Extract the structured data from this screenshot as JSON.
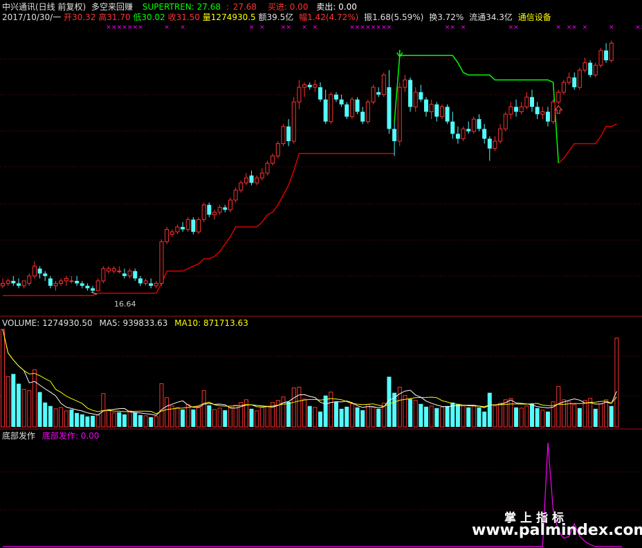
{
  "header": {
    "line1": {
      "stock": "中兴通讯(日线 前复权)",
      "indicator": "多空来回赚",
      "st_label": "SUPERTREN: 27.68",
      "st_value2": "27.68",
      "buy": "买进: 0.00",
      "sell": "卖出: 0.00"
    },
    "line2": {
      "date": "2017/10/30/一",
      "open": "开30.32",
      "high": "高31.70",
      "low": "低30.02",
      "close": "收31.50",
      "vol": "量1274930.5",
      "amount": "额39.5亿",
      "change": "幅1.42(4.72%)",
      "amplitude": "振1.68(5.59%)",
      "turnover": "换3.72%",
      "float": "流通34.3亿",
      "sector": "通信设备"
    }
  },
  "panels": {
    "volume_title": "VOLUME: 1274930.50",
    "ma5_label": "MA5: 939833.63",
    "ma10_label": "MA10: 871713.63",
    "bottom_title": "底部发作",
    "bottom_value": "底部发作: 0.00"
  },
  "annotations": {
    "low_label": "16.64"
  },
  "watermark": {
    "cn": "掌上指标",
    "url": "www.palmindex.com"
  },
  "colors": {
    "up": "#ff3232",
    "down": "#54fcfc",
    "supertrend_down": "#00ff00",
    "supertrend_up": "#dd0000",
    "marker": "#ff00ff",
    "ma5": "#ffffff",
    "ma10": "#ffff00",
    "bottom_signal": "#ff00ff"
  },
  "chart_data": [
    {
      "type": "candlestick",
      "series_name": "中兴通讯",
      "candles": [
        [
          16.9,
          17.2,
          16.8,
          17.0
        ],
        [
          17.0,
          17.2,
          16.9,
          17.1
        ],
        [
          17.1,
          17.3,
          16.9,
          17.0
        ],
        [
          17.0,
          17.2,
          16.8,
          16.9
        ],
        [
          16.9,
          17.1,
          16.8,
          17.1
        ],
        [
          17.0,
          17.4,
          16.9,
          17.3
        ],
        [
          17.3,
          17.9,
          17.2,
          17.7
        ],
        [
          17.6,
          17.7,
          17.2,
          17.4
        ],
        [
          17.4,
          17.5,
          17.1,
          17.3
        ],
        [
          17.2,
          17.3,
          16.8,
          16.9
        ],
        [
          16.9,
          17.1,
          16.7,
          17.0
        ],
        [
          17.0,
          17.2,
          16.9,
          17.1
        ],
        [
          17.1,
          17.3,
          16.9,
          17.2
        ],
        [
          17.1,
          17.3,
          17.0,
          17.1
        ],
        [
          17.1,
          17.3,
          16.9,
          17.0
        ],
        [
          17.0,
          17.1,
          16.8,
          16.9
        ],
        [
          16.9,
          17.0,
          16.7,
          16.8
        ],
        [
          16.8,
          16.9,
          16.64,
          16.7
        ],
        [
          16.7,
          17.2,
          16.7,
          17.1
        ],
        [
          17.1,
          17.7,
          17.0,
          17.6
        ],
        [
          17.5,
          17.7,
          17.4,
          17.6
        ],
        [
          17.5,
          17.7,
          17.4,
          17.6
        ],
        [
          17.5,
          17.7,
          17.4,
          17.5
        ],
        [
          17.4,
          17.6,
          17.2,
          17.3
        ],
        [
          17.3,
          17.6,
          17.2,
          17.5
        ],
        [
          17.5,
          17.6,
          17.1,
          17.2
        ],
        [
          17.2,
          17.3,
          16.9,
          17.0
        ],
        [
          17.0,
          17.2,
          16.9,
          17.1
        ],
        [
          17.0,
          17.2,
          16.8,
          16.9
        ],
        [
          16.9,
          17.1,
          16.8,
          17.0
        ],
        [
          17.0,
          18.8,
          16.9,
          18.7
        ],
        [
          18.7,
          19.3,
          18.6,
          19.2
        ],
        [
          19.0,
          19.2,
          18.9,
          19.1
        ],
        [
          19.1,
          19.4,
          19.0,
          19.3
        ],
        [
          19.3,
          19.5,
          19.1,
          19.2
        ],
        [
          19.2,
          19.7,
          19.1,
          19.6
        ],
        [
          19.6,
          19.7,
          19.0,
          19.1
        ],
        [
          19.1,
          19.7,
          19.0,
          19.6
        ],
        [
          19.6,
          20.3,
          19.5,
          20.2
        ],
        [
          20.2,
          20.3,
          19.7,
          19.8
        ],
        [
          19.8,
          20.0,
          19.6,
          19.9
        ],
        [
          19.9,
          20.2,
          19.8,
          20.1
        ],
        [
          20.1,
          20.2,
          19.9,
          20.0
        ],
        [
          20.0,
          20.5,
          19.9,
          20.4
        ],
        [
          20.4,
          20.9,
          20.3,
          20.8
        ],
        [
          20.8,
          21.2,
          20.7,
          21.1
        ],
        [
          21.1,
          21.5,
          21.0,
          21.3
        ],
        [
          21.4,
          21.6,
          21.0,
          21.1
        ],
        [
          21.1,
          21.4,
          21.0,
          21.3
        ],
        [
          21.3,
          21.7,
          21.2,
          21.5
        ],
        [
          21.5,
          22.0,
          21.4,
          21.9
        ],
        [
          21.9,
          22.3,
          21.8,
          22.2
        ],
        [
          22.2,
          22.8,
          22.1,
          22.7
        ],
        [
          22.7,
          23.5,
          22.6,
          23.4
        ],
        [
          23.4,
          23.7,
          22.6,
          22.8
        ],
        [
          22.8,
          24.6,
          22.7,
          24.4
        ],
        [
          24.4,
          25.3,
          24.1,
          25.0
        ],
        [
          25.0,
          25.2,
          24.6,
          25.1
        ],
        [
          25.1,
          25.2,
          24.9,
          25.0
        ],
        [
          25.0,
          25.3,
          24.8,
          25.1
        ],
        [
          25.0,
          25.2,
          24.4,
          24.5
        ],
        [
          24.5,
          24.9,
          23.5,
          23.6
        ],
        [
          23.6,
          24.8,
          23.5,
          24.7
        ],
        [
          24.7,
          24.8,
          24.4,
          24.5
        ],
        [
          24.5,
          24.7,
          24.2,
          24.3
        ],
        [
          24.3,
          24.4,
          23.7,
          23.8
        ],
        [
          23.8,
          24.6,
          23.7,
          24.5
        ],
        [
          24.5,
          24.6,
          23.9,
          24.0
        ],
        [
          24.0,
          24.2,
          23.5,
          23.6
        ],
        [
          23.6,
          24.5,
          23.5,
          24.4
        ],
        [
          24.4,
          25.1,
          24.3,
          25.0
        ],
        [
          24.8,
          25.0,
          24.6,
          24.7
        ],
        [
          24.7,
          25.6,
          24.6,
          25.5
        ],
        [
          25.0,
          25.7,
          23.1,
          23.3
        ],
        [
          23.3,
          23.6,
          22.2,
          22.8
        ],
        [
          22.8,
          25.2,
          22.6,
          25.0
        ],
        [
          25.0,
          25.5,
          24.8,
          25.3
        ],
        [
          25.3,
          25.4,
          24.0,
          24.2
        ],
        [
          24.2,
          25.0,
          24.0,
          24.8
        ],
        [
          24.8,
          25.1,
          24.4,
          24.5
        ],
        [
          24.5,
          24.6,
          23.8,
          24.0
        ],
        [
          24.0,
          24.5,
          23.7,
          24.3
        ],
        [
          24.3,
          24.4,
          23.6,
          23.8
        ],
        [
          23.8,
          24.3,
          23.7,
          24.2
        ],
        [
          24.2,
          24.3,
          23.5,
          23.6
        ],
        [
          23.6,
          24.0,
          22.9,
          23.1
        ],
        [
          23.1,
          23.4,
          22.7,
          22.9
        ],
        [
          22.9,
          23.4,
          22.8,
          23.3
        ],
        [
          23.3,
          23.6,
          23.1,
          23.2
        ],
        [
          23.2,
          23.8,
          23.1,
          23.7
        ],
        [
          23.7,
          23.9,
          23.2,
          23.3
        ],
        [
          23.3,
          23.5,
          22.7,
          22.9
        ],
        [
          22.9,
          23.0,
          22.0,
          22.5
        ],
        [
          22.5,
          23.0,
          22.4,
          22.8
        ],
        [
          22.8,
          23.5,
          22.7,
          23.3
        ],
        [
          23.3,
          24.0,
          23.2,
          23.9
        ],
        [
          23.9,
          24.4,
          23.7,
          24.2
        ],
        [
          24.2,
          24.5,
          23.8,
          24.0
        ],
        [
          24.0,
          24.4,
          23.9,
          24.2
        ],
        [
          24.2,
          24.8,
          24.1,
          24.6
        ],
        [
          24.6,
          24.9,
          24.0,
          24.2
        ],
        [
          24.2,
          24.4,
          23.7,
          23.9
        ],
        [
          23.9,
          24.2,
          23.7,
          24.0
        ],
        [
          24.0,
          24.2,
          23.4,
          23.6
        ],
        [
          23.6,
          24.5,
          23.5,
          24.4
        ],
        [
          24.4,
          24.9,
          24.3,
          24.8
        ],
        [
          24.8,
          25.3,
          24.7,
          25.2
        ],
        [
          25.2,
          25.6,
          25.1,
          25.4
        ],
        [
          25.4,
          25.6,
          24.9,
          25.0
        ],
        [
          25.0,
          25.8,
          24.9,
          25.7
        ],
        [
          25.7,
          26.2,
          25.6,
          26.0
        ],
        [
          26.0,
          26.1,
          25.4,
          25.5
        ],
        [
          25.5,
          26.0,
          25.4,
          25.9
        ],
        [
          25.9,
          26.6,
          25.8,
          26.5
        ],
        [
          26.5,
          26.8,
          26.0,
          26.1
        ],
        [
          26.1,
          26.9,
          26.0,
          26.8
        ]
      ],
      "supertrend": [
        16.5,
        16.5,
        16.5,
        16.5,
        16.5,
        16.5,
        16.5,
        16.5,
        16.5,
        16.5,
        16.5,
        16.5,
        16.5,
        16.5,
        16.5,
        16.5,
        16.5,
        16.5,
        16.6,
        16.6,
        16.6,
        16.6,
        16.6,
        16.6,
        16.6,
        16.6,
        16.6,
        16.6,
        16.6,
        16.6,
        17.0,
        17.5,
        17.5,
        17.5,
        17.5,
        17.6,
        17.7,
        17.8,
        18.0,
        18.0,
        18.1,
        18.3,
        18.6,
        18.9,
        19.3,
        19.3,
        19.3,
        19.3,
        19.3,
        19.5,
        19.8,
        19.9,
        20.2,
        20.6,
        21.0,
        21.6,
        22.3,
        22.3,
        22.3,
        22.3,
        22.3,
        22.3,
        22.3,
        22.3,
        22.3,
        22.3,
        22.3,
        22.3,
        22.3,
        22.3,
        22.3,
        22.3,
        22.3,
        22.3,
        22.3,
        26.3,
        26.3,
        26.3,
        26.3,
        26.3,
        26.3,
        26.3,
        26.3,
        26.3,
        26.3,
        26.3,
        26.0,
        25.6,
        25.5,
        25.5,
        25.5,
        25.5,
        25.5,
        25.3,
        25.3,
        25.3,
        25.3,
        25.3,
        25.3,
        25.3,
        25.3,
        25.3,
        25.3,
        25.3,
        25.2,
        21.9,
        22.1,
        22.4,
        22.7,
        22.7,
        22.7,
        22.7,
        22.7,
        23.0,
        23.4,
        23.4,
        23.5
      ],
      "supertrend_switch_down_index": 75,
      "supertrend_switch_up_index": 105,
      "ylim": [
        15.8,
        27.6
      ]
    },
    {
      "type": "bar",
      "series_name": "VOLUME",
      "values": [
        1400000,
        720000,
        760000,
        620000,
        540000,
        520000,
        820000,
        500000,
        350000,
        300000,
        260000,
        280000,
        230000,
        250000,
        200000,
        180000,
        150000,
        160000,
        170000,
        480000,
        250000,
        200000,
        210000,
        180000,
        230000,
        210000,
        170000,
        160000,
        140000,
        150000,
        620000,
        420000,
        300000,
        280000,
        250000,
        320000,
        250000,
        290000,
        520000,
        310000,
        250000,
        270000,
        240000,
        280000,
        310000,
        350000,
        390000,
        260000,
        230000,
        280000,
        300000,
        350000,
        380000,
        430000,
        360000,
        560000,
        570000,
        400000,
        300000,
        280000,
        220000,
        450000,
        500000,
        360000,
        260000,
        290000,
        330000,
        280000,
        240000,
        320000,
        280000,
        260000,
        340000,
        720000,
        490000,
        570000,
        450000,
        400000,
        380000,
        330000,
        290000,
        300000,
        270000,
        280000,
        300000,
        350000,
        330000,
        300000,
        280000,
        300000,
        280000,
        220000,
        490000,
        300000,
        340000,
        390000,
        410000,
        280000,
        270000,
        300000,
        330000,
        270000,
        240000,
        220000,
        360000,
        580000,
        390000,
        360000,
        320000,
        270000,
        380000,
        410000,
        260000,
        330000,
        390000,
        300000,
        1274930
      ],
      "up_flags": [
        1,
        1,
        0,
        0,
        1,
        1,
        1,
        0,
        0,
        0,
        1,
        1,
        1,
        0,
        0,
        0,
        0,
        0,
        1,
        1,
        1,
        1,
        0,
        0,
        1,
        0,
        0,
        1,
        0,
        1,
        1,
        1,
        1,
        1,
        0,
        1,
        0,
        1,
        1,
        0,
        1,
        1,
        0,
        1,
        1,
        1,
        1,
        0,
        1,
        1,
        1,
        1,
        1,
        1,
        0,
        1,
        1,
        1,
        0,
        1,
        0,
        0,
        1,
        0,
        0,
        0,
        1,
        0,
        0,
        1,
        1,
        0,
        1,
        0,
        0,
        1,
        1,
        0,
        1,
        0,
        0,
        1,
        0,
        1,
        0,
        0,
        0,
        1,
        0,
        1,
        0,
        0,
        0,
        1,
        1,
        1,
        1,
        0,
        1,
        1,
        0,
        0,
        1,
        0,
        1,
        1,
        1,
        1,
        1,
        0,
        1,
        1,
        0,
        1,
        1,
        0,
        1
      ],
      "ma5_last": 939833.63,
      "ma10_last": 871713.63
    },
    {
      "type": "line",
      "series_name": "底部发作",
      "values": [
        0,
        0,
        0,
        0,
        0,
        0,
        0,
        0,
        0,
        0,
        0,
        0,
        0,
        0,
        0,
        0,
        0,
        0,
        0,
        0,
        0,
        0,
        0,
        0,
        0,
        0,
        0,
        0,
        0,
        0,
        0,
        0,
        0,
        0,
        0,
        0,
        0,
        0,
        0,
        0,
        0,
        0,
        0,
        0,
        0,
        0,
        0,
        0,
        0,
        0,
        0,
        0,
        0,
        0,
        0,
        0,
        0,
        0,
        0,
        0,
        0,
        0,
        0,
        0,
        0,
        0,
        0,
        0,
        0,
        0,
        0,
        0,
        0,
        0,
        0,
        0,
        0,
        0,
        0,
        0,
        0,
        0,
        0,
        0,
        0,
        0,
        0,
        0,
        0,
        0,
        0,
        0,
        0,
        0,
        0,
        0,
        0,
        0,
        0,
        0,
        0,
        0,
        0,
        1.0,
        0.35,
        0.15,
        0.08,
        0.1,
        0.22,
        0.1,
        0.05,
        0.02,
        0,
        0,
        0,
        0,
        0,
        0
      ],
      "last": 0.0
    }
  ]
}
